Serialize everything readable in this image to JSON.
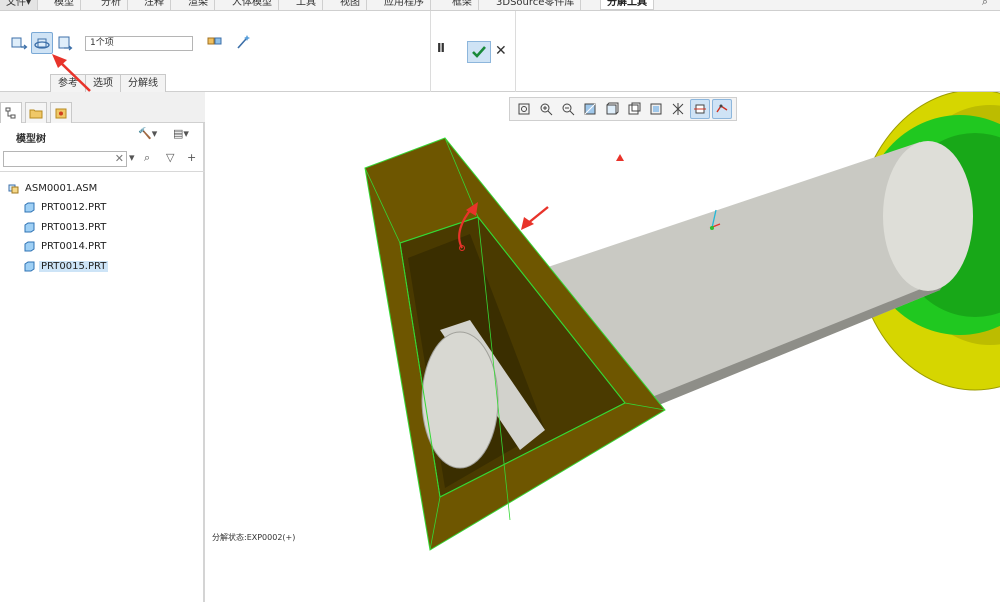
{
  "menubar": {
    "items": [
      "文件▾",
      "模型",
      "分析",
      "注释",
      "渲染",
      "人体模型",
      "工具",
      "视图",
      "应用程序",
      "框架",
      "3DSource零件库"
    ],
    "active_tab": "分解工具"
  },
  "dashboard": {
    "reference_field": "1个项",
    "subtabs": [
      "参考",
      "选项",
      "分解线"
    ],
    "pause_label": "II",
    "ok_icon": "checkmark-icon",
    "cancel_label": "✕"
  },
  "model_tree": {
    "title": "模型树",
    "search_placeholder": "",
    "root": "ASM0001.ASM",
    "parts": [
      "PRT0012.PRT",
      "PRT0013.PRT",
      "PRT0014.PRT",
      "PRT0015.PRT"
    ],
    "selected_part": "PRT0015.PRT"
  },
  "viewport": {
    "status": "分解状态:EXP0002(+)",
    "view_toolbar_icons": [
      "refit-icon",
      "zoom-in-icon",
      "zoom-out-icon",
      "repaint-icon",
      "display-style-icon",
      "saved-orientations-icon",
      "view-manager-icon",
      "datum-display-icon",
      "spin-center-icon",
      "annotation-display-icon"
    ],
    "colors": {
      "bracket": "#6e5600",
      "bracket_edge": "#35d835",
      "shaft": "#c8c8c2",
      "collar": "#22d822",
      "ring": "#d8d800",
      "arrow": "#e8332a"
    }
  }
}
